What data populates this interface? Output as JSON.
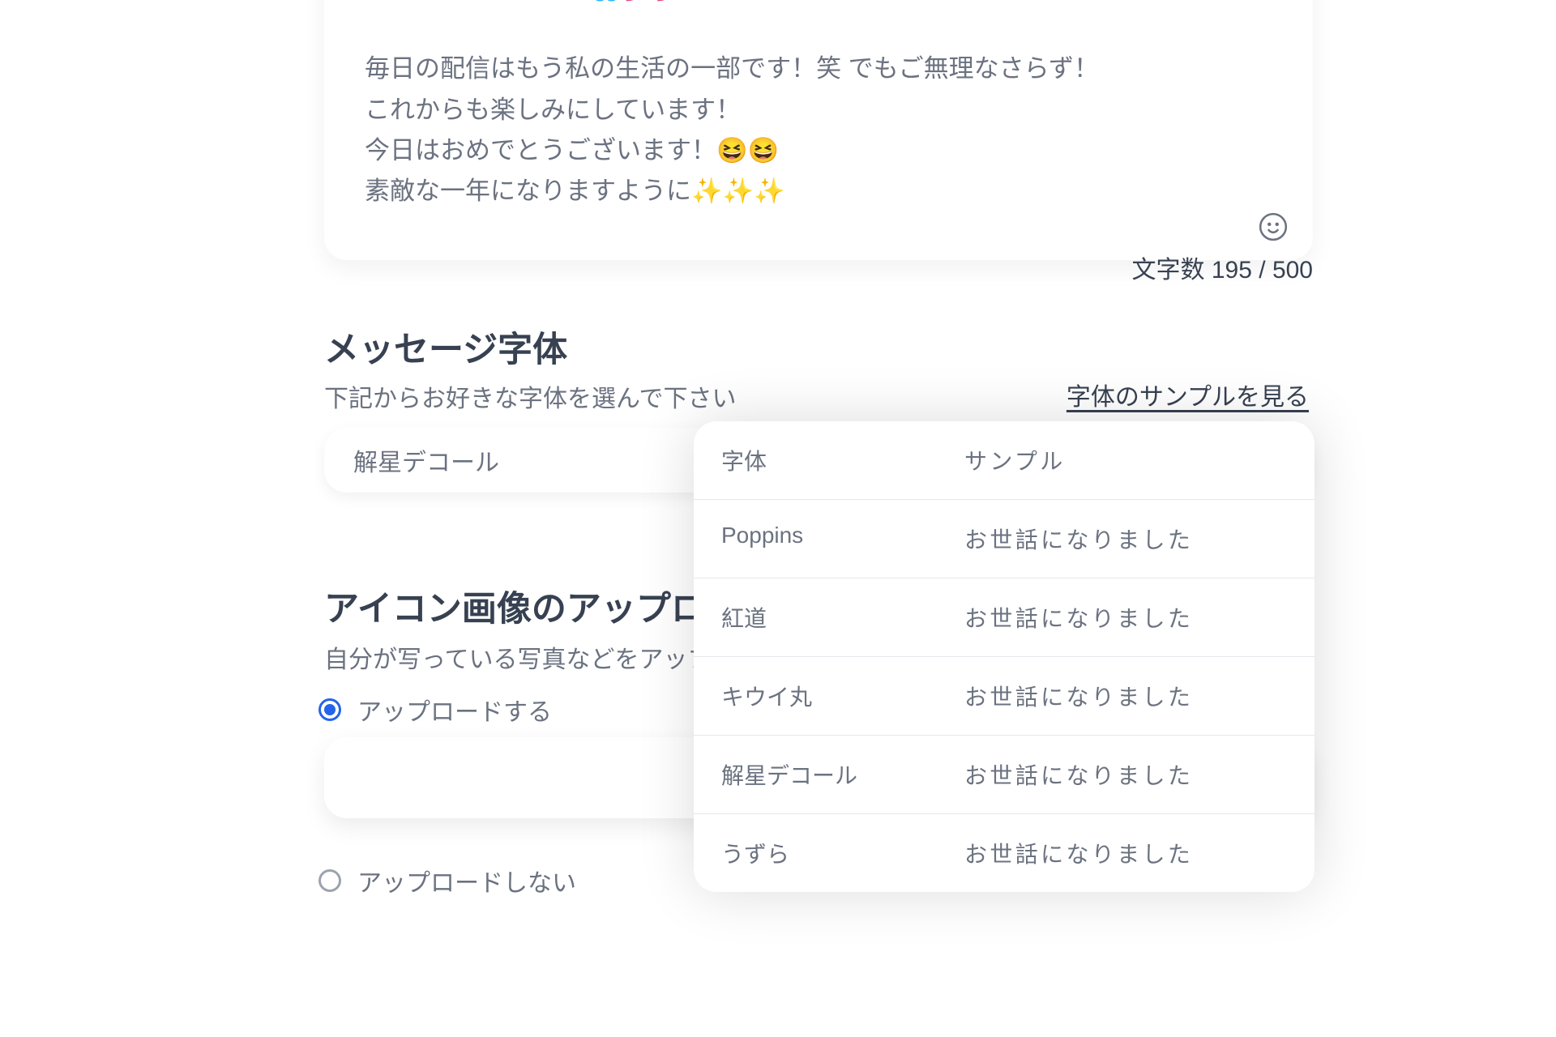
{
  "message": {
    "body": "感謝しかありません😭💕💕\n\n毎日の配信はもう私の生活の一部です！笑 でもご無理なさらず！\nこれからも楽しみにしています！\n今日はおめでとうございます！😆😆\n素敵な一年になりますように✨✨✨",
    "counter_label": "文字数",
    "count": "195",
    "limit": "500"
  },
  "font_section": {
    "title": "メッセージ字体",
    "subtitle": "下記からお好きな字体を選んで下さい",
    "link": "字体のサンプルを見る",
    "selected": "解星デコール"
  },
  "upload_section": {
    "title": "アイコン画像のアップロード",
    "subtitle": "自分が写っている写真などをアップ",
    "option_upload": "アップロードする",
    "option_no_upload": "アップロードしない",
    "selected_option": "upload"
  },
  "popup": {
    "header_font": "字体",
    "header_sample": "サンプル",
    "rows": [
      {
        "name": "Poppins",
        "sample": "お世話になりました"
      },
      {
        "name": "紅道",
        "sample": "お世話になりました"
      },
      {
        "name": "キウイ丸",
        "sample": "お世話になりました"
      },
      {
        "name": "解星デコール",
        "sample": "お世話になりました"
      },
      {
        "name": "うずら",
        "sample": "お世話になりました"
      }
    ]
  },
  "colors": {
    "accent": "#2563eb"
  }
}
